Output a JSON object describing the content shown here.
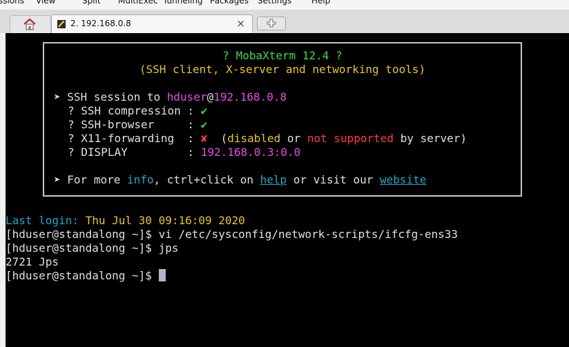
{
  "menu": [
    "ssions",
    "View",
    "Split",
    "MultiExec",
    "Tunneling",
    "Packages",
    "Settings",
    "Help"
  ],
  "tabs": {
    "session_label": "2. 192.168.0.8",
    "close_glyph": "×"
  },
  "banner": {
    "title": "? MobaXterm 12.4 ?",
    "subtitle": "(SSH client, X-server and networking tools)",
    "arrow": "➤",
    "session_prefix": "SSH session to ",
    "user": "hduser",
    "at": "@",
    "host": "192.168.0.8",
    "rows": [
      {
        "bullet": "?",
        "label": "SSH compression",
        "sep": ":",
        "value": "✔"
      },
      {
        "bullet": "?",
        "label": "SSH-browser",
        "sep": ":",
        "value": "✔"
      },
      {
        "bullet": "?",
        "label": "X11-forwarding",
        "sep": ":",
        "value": "✘"
      },
      {
        "bullet": "?",
        "label": "DISPLAY",
        "sep": ":",
        "value": "192.168.0.3:0.0"
      }
    ],
    "x11_note": {
      "open": "(",
      "disabled": "disabled",
      "or": " or ",
      "not_supported": "not supported",
      "rest": " by server)"
    },
    "footer": {
      "prefix": "For more ",
      "info": "info",
      "middle": ", ctrl+click on ",
      "help": "help",
      "or_visit": " or visit our ",
      "website": "website"
    }
  },
  "console": {
    "last_login_label": "Last login:",
    "last_login_value": " Thu Jul 30 09:16:09 2020",
    "prompt": "[hduser@standalong ~]$ ",
    "cmd1": "vi /etc/sysconfig/network-scripts/ifcfg-ens33",
    "cmd2": "jps",
    "output1": "2721 Jps"
  },
  "colors": {
    "terminal_bg": "#000000",
    "green": "#3ddb53",
    "yellow": "#e6c33a",
    "magenta": "#e64de6",
    "red": "#ff3c3c",
    "cyan": "#21a7c5"
  },
  "icons": [
    "home-icon",
    "ssh-session-icon",
    "close-icon",
    "add-tab-icon"
  ]
}
